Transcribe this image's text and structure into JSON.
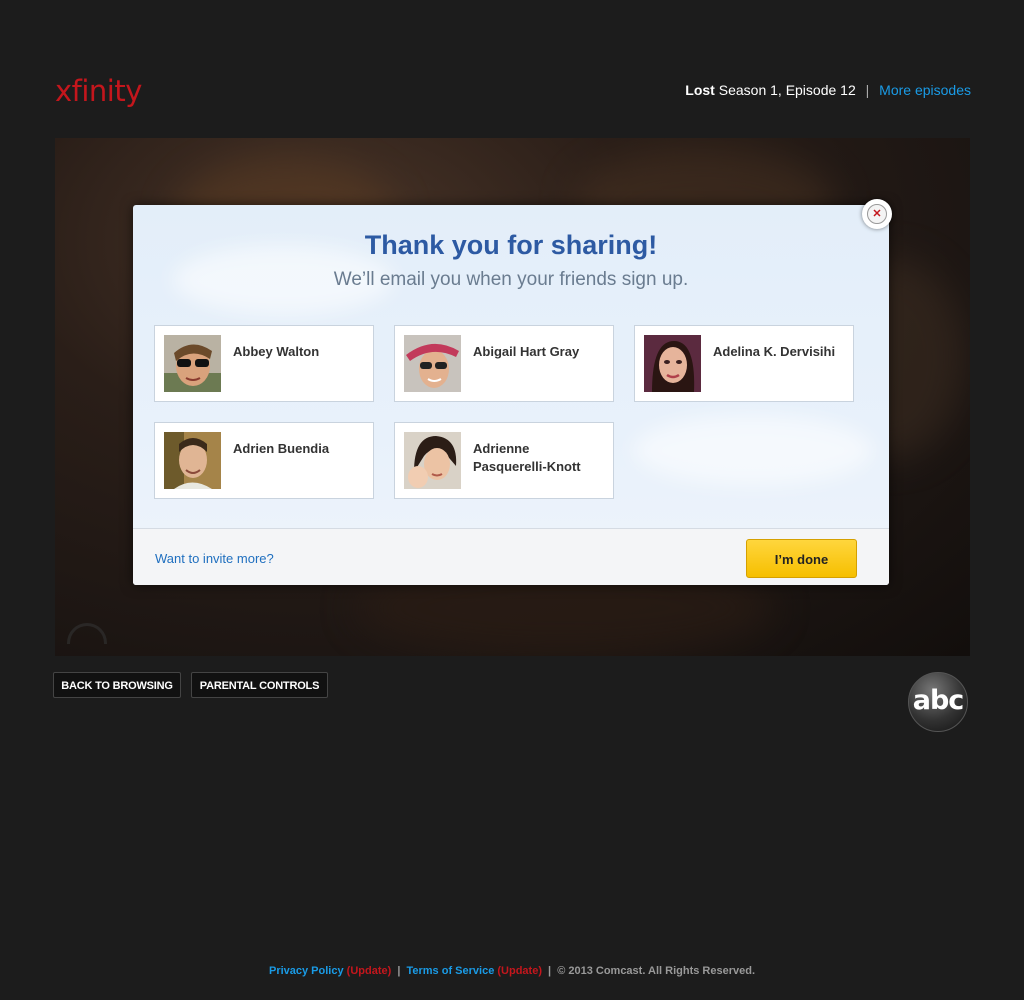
{
  "header": {
    "logo_text": "xfinity",
    "show_title": "Lost",
    "episode": "Season 1, Episode 12",
    "separator": "|",
    "more_episodes": "More episodes"
  },
  "modal": {
    "title": "Thank you for sharing!",
    "subtitle": "We’ll email you when your friends sign up.",
    "friends": [
      {
        "name": "Abbey Walton",
        "avatar": "avatar-abbey"
      },
      {
        "name": "Abigail Hart Gray",
        "avatar": "avatar-abigail"
      },
      {
        "name": "Adelina K. Dervisihi",
        "avatar": "avatar-adelina"
      },
      {
        "name": "Adrien Buendia",
        "avatar": "avatar-adrien"
      },
      {
        "name": "Adrienne Pasquerelli-Knott",
        "avatar": "avatar-adrienne"
      }
    ],
    "invite_more": "Want to invite more?",
    "done_label": "I’m done",
    "close_glyph": "✕"
  },
  "nav": {
    "back_to_browsing": "BACK TO BROWSING",
    "parental_controls": "PARENTAL CONTROLS"
  },
  "network_logo": "abc",
  "footer": {
    "privacy_policy": "Privacy Policy",
    "privacy_update": "(Update)",
    "terms_of_service": "Terms of Service",
    "terms_update": "(Update)",
    "copyright": "© 2013 Comcast. All Rights Reserved.",
    "separator": "|"
  },
  "colors": {
    "brand_red": "#c4161c",
    "link_blue": "#1a9be6",
    "title_blue": "#2d5aa3",
    "done_yellow": "#f6bf00"
  }
}
